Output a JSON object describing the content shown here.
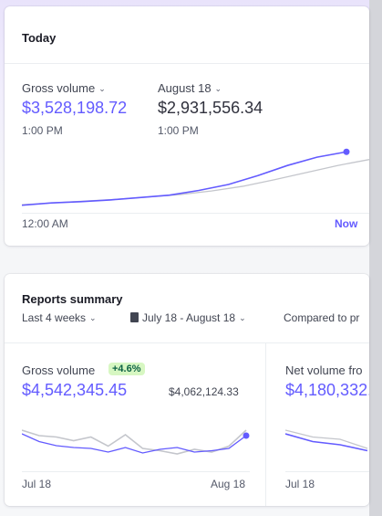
{
  "today": {
    "title": "Today",
    "gross_label": "Gross volume",
    "gross_value": "$3,528,198.72",
    "gross_time": "1:00 PM",
    "compare_label": "August 18",
    "compare_value": "$2,931,556.34",
    "compare_time": "1:00 PM",
    "axis_start": "12:00 AM",
    "axis_end": "Now",
    "chart": {
      "type": "line",
      "series": [
        {
          "values": [
            0.05,
            0.09,
            0.11,
            0.14,
            0.18,
            0.22,
            0.3,
            0.4,
            0.55,
            0.72,
            0.86,
            0.95
          ]
        },
        {
          "values": [
            0.06,
            0.09,
            0.12,
            0.15,
            0.19,
            0.23,
            0.29,
            0.37,
            0.48,
            0.6,
            0.72,
            0.82
          ]
        }
      ]
    }
  },
  "reports": {
    "title": "Reports summary",
    "period_filter": "Last 4 weeks",
    "date_range": "July 18 - August 18",
    "compare_filter": "Compared to pr",
    "gross": {
      "label": "Gross volume",
      "change": "+4.6%",
      "value": "$4,542,345.45",
      "previous": "$4,062,124.33",
      "axis_start": "Jul 18",
      "axis_end": "Aug 18"
    },
    "net": {
      "label": "Net volume fro",
      "value": "$4,180,332.",
      "axis_start": "Jul 18"
    }
  },
  "chart_data": [
    {
      "type": "line",
      "series": [
        {
          "values": [
            0.62,
            0.45,
            0.36,
            0.32,
            0.3,
            0.22,
            0.32,
            0.2,
            0.28,
            0.32,
            0.22,
            0.25,
            0.3,
            0.58
          ]
        },
        {
          "values": [
            0.7,
            0.58,
            0.55,
            0.47,
            0.55,
            0.35,
            0.6,
            0.3,
            0.25,
            0.18,
            0.28,
            0.22,
            0.35,
            0.7
          ]
        }
      ]
    }
  ],
  "colors": {
    "accent": "#635bff",
    "comparison": "#c4c6cc",
    "badge_bg": "#d7f7c2"
  }
}
